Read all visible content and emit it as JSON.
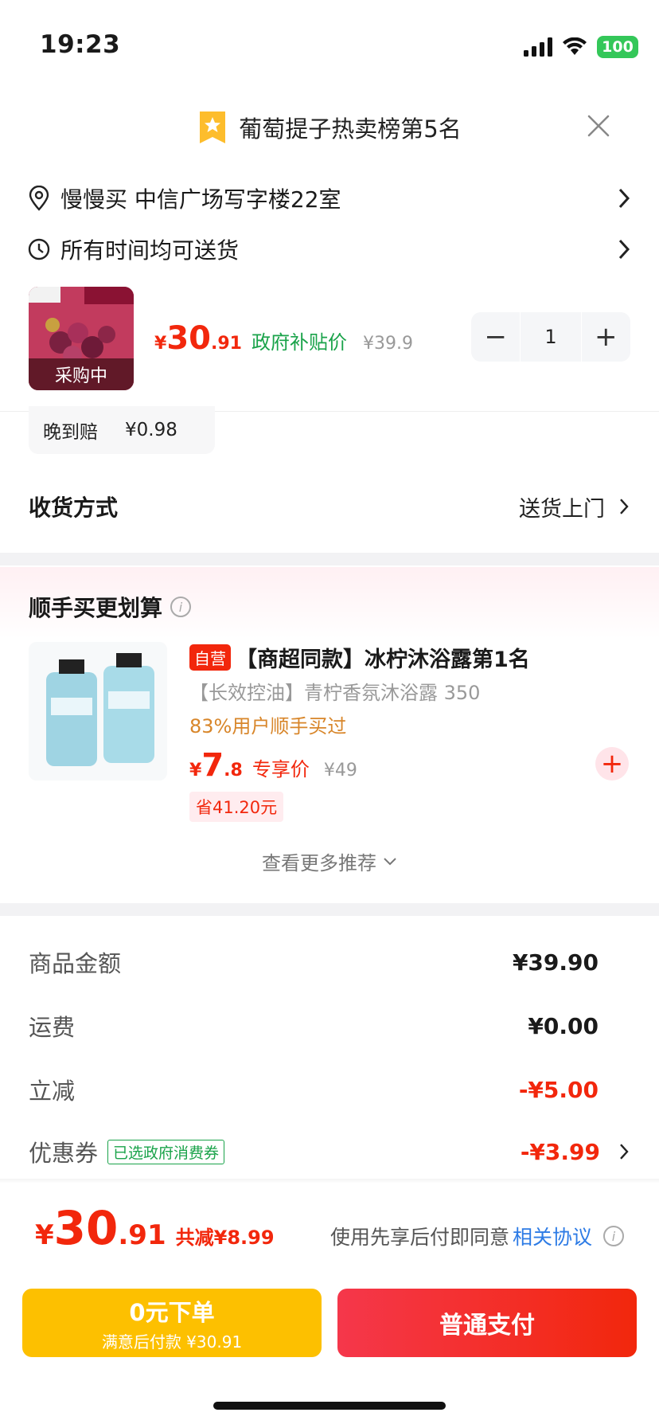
{
  "status_bar": {
    "time": "19:23",
    "battery": "100"
  },
  "header": {
    "rank_text": "葡萄提子热卖榜第5名"
  },
  "address": {
    "text": "慢慢买  中信广场写字楼22室"
  },
  "delivery_time": {
    "text": "所有时间均可送货"
  },
  "product": {
    "status_tag": "采购中",
    "price_yen": "¥",
    "price_int": "30",
    "price_dec": ".91",
    "price_label": "政府补贴价",
    "orig_price": "¥39.9",
    "quantity": "1",
    "minus": "−",
    "plus": "+"
  },
  "late_comp": {
    "label": "晚到赔",
    "value": "¥0.98"
  },
  "delivery_method": {
    "label": "收货方式",
    "value": "送货上门"
  },
  "recommend": {
    "title": "顺手买更划算",
    "self_tag": "自营",
    "name": "【商超同款】冰柠沐浴露第1名",
    "subtitle": "【长效控油】青柠香氛沐浴露 350",
    "buy_rate": "83%用户顺手买过",
    "price_yen": "¥",
    "price_int": "7",
    "price_dec": ".8",
    "price_label": "专享价",
    "orig_price": "¥49",
    "save": "省41.20元",
    "more": "查看更多推荐"
  },
  "summary": {
    "goods_label": "商品金额",
    "goods_value": "¥39.90",
    "shipping_label": "运费",
    "shipping_value": "¥0.00",
    "discount_label": "立减",
    "discount_value": "-¥5.00",
    "coupon_label": "优惠券",
    "coupon_badge": "已选政府消费券",
    "coupon_value": "-¥3.99"
  },
  "footer": {
    "total_yen": "¥",
    "total_int": "30",
    "total_dec": ".91",
    "total_save": "共减¥8.99",
    "agree_text": "使用先享后付即同意",
    "agree_link": "相关协议",
    "zero_btn_main": "0元下单",
    "zero_btn_sub": "满意后付款 ¥30.91",
    "pay_btn": "普通支付"
  },
  "colors": {
    "accent_red": "#f2270c",
    "gov_green": "#1aa34a",
    "zero_yellow": "#fdc000",
    "link_blue": "#2d7be5"
  }
}
